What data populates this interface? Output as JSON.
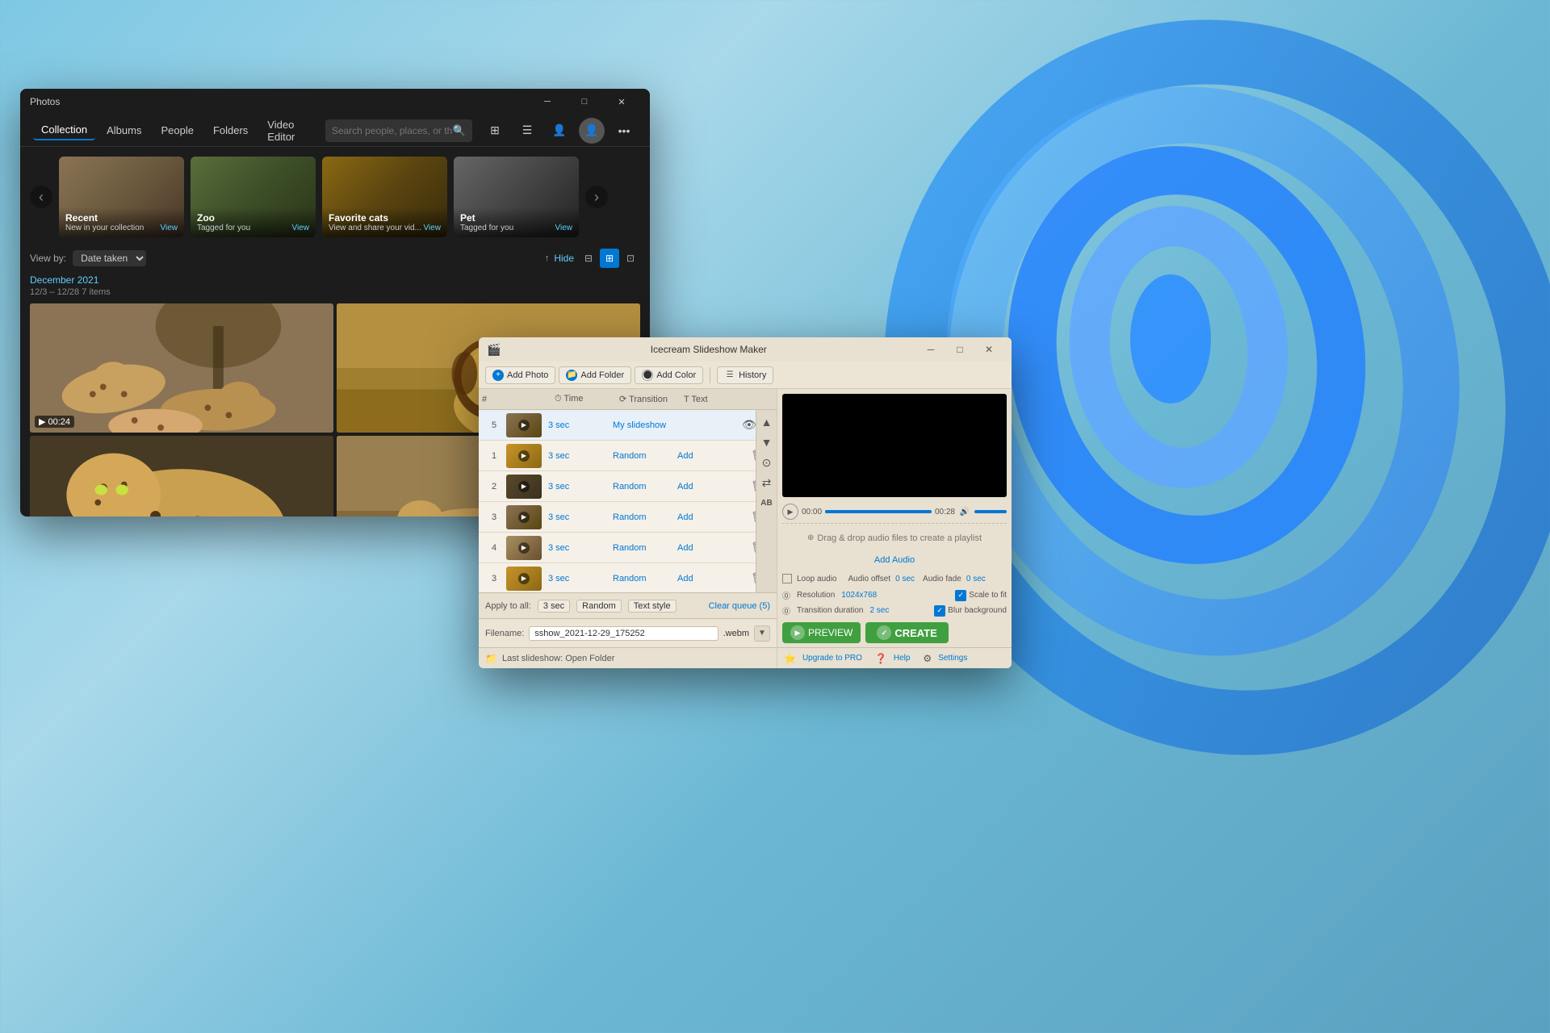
{
  "desktop": {
    "bg_color": "#7ec8e3"
  },
  "photos_app": {
    "title": "Photos",
    "nav_items": [
      "Collection",
      "Albums",
      "People",
      "Folders",
      "Video Editor"
    ],
    "active_nav": "Collection",
    "search_placeholder": "Search people, places, or things...",
    "albums": [
      {
        "title": "Recent",
        "sub": "New in your collection",
        "has_view": true
      },
      {
        "title": "Zoo",
        "sub": "Tagged for you",
        "has_view": true
      },
      {
        "title": "Favorite cats",
        "sub": "View and share your vid...",
        "has_view": true
      },
      {
        "title": "Pet",
        "sub": "Tagged for you",
        "has_view": true
      }
    ],
    "view_by_label": "View by:",
    "view_by_value": "Date taken",
    "hide_label": "Hide",
    "date_section": "December 2021",
    "date_range": "12/3 – 12/28  7 items",
    "video_duration": "00:24",
    "view_label": "View"
  },
  "slideshow_app": {
    "title": "Icecream Slideshow Maker",
    "toolbar": {
      "add_photo": "Add Photo",
      "add_folder": "Add Folder",
      "add_color": "Add Color",
      "history": "History"
    },
    "list_headers": {
      "num": "#",
      "time": "Time",
      "transition": "Transition",
      "text": "Text",
      "delete": ""
    },
    "rows": [
      {
        "num": "5",
        "time": "3 sec",
        "transition": "My slideshow",
        "text": "",
        "is_active": true,
        "has_eye": true
      },
      {
        "num": "1",
        "time": "3 sec",
        "transition": "Random",
        "text": "Add",
        "is_active": false,
        "has_eye": false
      },
      {
        "num": "2",
        "time": "3 sec",
        "transition": "Random",
        "text": "Add",
        "is_active": false,
        "has_eye": false
      },
      {
        "num": "3",
        "time": "3 sec",
        "transition": "Random",
        "text": "Add",
        "is_active": false,
        "has_eye": false
      },
      {
        "num": "4",
        "time": "3 sec",
        "transition": "Random",
        "text": "Add",
        "is_active": false,
        "has_eye": false
      },
      {
        "num": "3",
        "time": "3 sec",
        "transition": "Random",
        "text": "Add",
        "is_active": false,
        "has_eye": false
      }
    ],
    "apply_to_all": "Apply to all:",
    "apply_time": "3 sec",
    "apply_trans": "Random",
    "apply_text": "Text style",
    "clear_queue": "Clear queue (5)",
    "filename_label": "Filename:",
    "filename_value": "sshow_2021-12-29_175252",
    "filename_ext": ".webm",
    "last_slideshow": "Last slideshow: Open Folder",
    "audio": {
      "time_start": "00:00",
      "time_end": "00:28",
      "loop_label": "Loop audio",
      "offset_label": "Audio offset",
      "offset_val": "0 sec",
      "fade_label": "Audio fade",
      "fade_val": "0 sec",
      "drop_text": "Drag & drop audio files to create a playlist",
      "add_audio": "Add Audio"
    },
    "settings": {
      "resolution_label": "Resolution",
      "resolution_val": "1024x768",
      "transition_dur_label": "Transition duration",
      "transition_dur_val": "2 sec",
      "scale_label": "Scale to fit",
      "blur_label": "Blur background"
    },
    "upgrade_label": "Upgrade to PRO",
    "help_label": "Help",
    "settings_label": "Settings",
    "preview_btn": "PREVIEW",
    "create_btn": "CREATE"
  }
}
